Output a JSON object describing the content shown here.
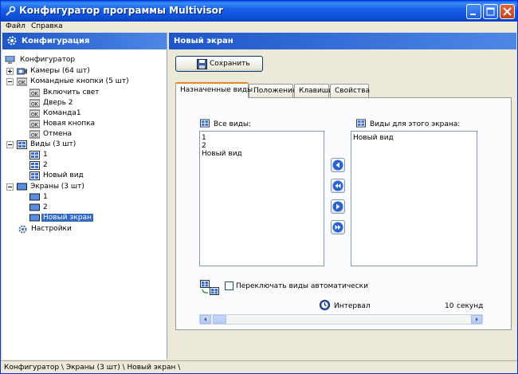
{
  "window": {
    "title": "Конфигуратор программы Multivisor"
  },
  "menu": {
    "items": [
      "Файл",
      "Справка"
    ]
  },
  "left_panel": {
    "header": "Конфигурация",
    "tree": [
      {
        "label": "Конфигуратор",
        "icon": "computer-icon"
      },
      {
        "label": "Камеры (64 шт)",
        "icon": "camera-icon"
      },
      {
        "label": "Командные кнопки (5 шт)",
        "icon": "ok-button-icon"
      },
      {
        "label": "Включить свет",
        "icon": "ok-button-icon"
      },
      {
        "label": "Дверь 2",
        "icon": "ok-button-icon"
      },
      {
        "label": "Команда1",
        "icon": "ok-button-icon"
      },
      {
        "label": "Новая кнопка",
        "icon": "ok-button-icon"
      },
      {
        "label": "Отмена",
        "icon": "ok-button-icon"
      },
      {
        "label": "Виды (3 шт)",
        "icon": "grid-view-icon"
      },
      {
        "label": "1",
        "icon": "grid-view-icon"
      },
      {
        "label": "2",
        "icon": "grid-view-icon"
      },
      {
        "label": "Новый вид",
        "icon": "grid-view-icon"
      },
      {
        "label": "Экраны (3 шт)",
        "icon": "screen-icon"
      },
      {
        "label": "1",
        "icon": "screen-icon"
      },
      {
        "label": "2",
        "icon": "screen-icon"
      },
      {
        "label": "Новый экран",
        "icon": "screen-icon",
        "selected": true
      },
      {
        "label": "Настройки",
        "icon": "gear-icon"
      }
    ]
  },
  "right_panel": {
    "header": "Новый экран",
    "save_label": "Сохранить",
    "tabs": [
      "Назначенные виды",
      "Положение",
      "Клавиши",
      "Свойства"
    ],
    "active_tab": "Назначенные виды",
    "all_views_label": "Все виды:",
    "all_views": [
      "1",
      "2",
      "Новый вид"
    ],
    "screen_views_label": "Виды для этого экрана:",
    "screen_views": [
      "Новый вид"
    ],
    "auto_switch_label": "Переключать виды автоматически",
    "auto_switch_checked": false,
    "interval_label": "Интервал",
    "interval_value": "10",
    "interval_unit": "секунд"
  },
  "status": {
    "path": "Конфигуратор \\ Экраны (3 шт) \\ Новый экран \\"
  },
  "colors": {
    "accent": "#316ac5",
    "titlebar": "#0a5fe8",
    "panel_header": "#1e56c9",
    "tab_highlight": "#e68b2c"
  }
}
